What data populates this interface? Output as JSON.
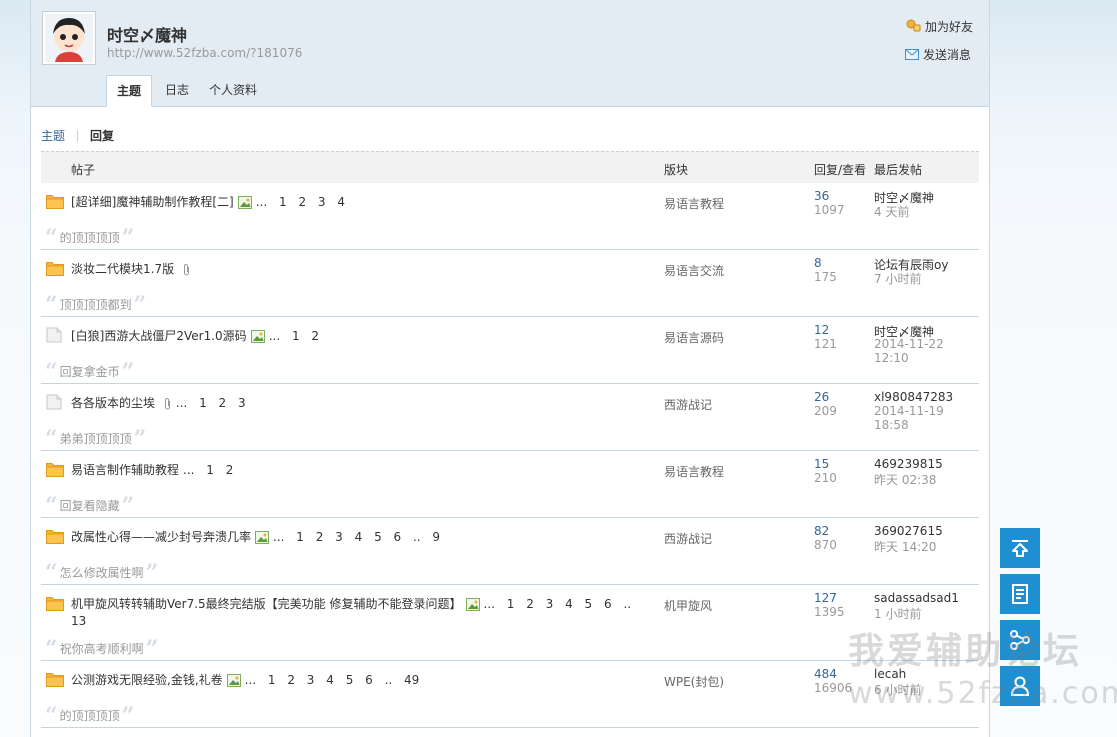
{
  "profile": {
    "name": "时空〆魔神",
    "url": "http://www.52fzba.com/?181076",
    "add_friend": "加为好友",
    "send_message": "发送消息"
  },
  "tabs": [
    "主题",
    "日志",
    "个人资料"
  ],
  "subnav": {
    "topics": "主题",
    "replies": "回复"
  },
  "table_headers": {
    "post": "帖子",
    "forum": "版块",
    "reply_view": "回复/查看",
    "last_post": "最后发帖"
  },
  "threads": [
    {
      "title": "[超详细]魔神辅助制作教程[二]",
      "has_image": true,
      "has_attach": false,
      "pages": "... 1 2 3 4",
      "forum": "易语言教程",
      "replies": "36",
      "views": "1097",
      "last_user": "时空〆魔神",
      "last_time": "4 天前",
      "quote": "的顶顶顶顶",
      "folder": "yellow"
    },
    {
      "title": "淡妆二代模块1.7版",
      "has_image": false,
      "has_attach": true,
      "pages": "",
      "forum": "易语言交流",
      "replies": "8",
      "views": "175",
      "last_user": "论坛有辰雨oy",
      "last_time": "7 小时前",
      "quote": "顶顶顶顶都到",
      "folder": "yellow"
    },
    {
      "title": "[白狼]西游大战僵尸2Ver1.0源码",
      "has_image": true,
      "has_attach": false,
      "pages": "... 1 2",
      "forum": "易语言源码",
      "replies": "12",
      "views": "121",
      "last_user": "时空〆魔神",
      "last_time": "2014-11-22 12:10",
      "quote": "回复拿金币",
      "folder": "gray"
    },
    {
      "title": "各各版本的尘埃",
      "has_image": false,
      "has_attach": true,
      "pages": "... 1 2 3",
      "forum": "西游战记",
      "replies": "26",
      "views": "209",
      "last_user": "xl980847283",
      "last_time": "2014-11-19 18:58",
      "quote": "弟弟顶顶顶顶",
      "folder": "gray"
    },
    {
      "title": "易语言制作辅助教程",
      "has_image": false,
      "has_attach": false,
      "pages": "... 1 2",
      "forum": "易语言教程",
      "replies": "15",
      "views": "210",
      "last_user": "469239815",
      "last_time": "昨天 02:38",
      "quote": "回复看隐藏",
      "folder": "yellow"
    },
    {
      "title": "改属性心得——减少封号奔溃几率",
      "has_image": true,
      "has_attach": false,
      "pages": "... 1 2 3 4 5 6 .. 9",
      "forum": "西游战记",
      "replies": "82",
      "views": "870",
      "last_user": "369027615",
      "last_time": "昨天 14:20",
      "quote": "怎么修改属性啊",
      "folder": "yellow"
    },
    {
      "title": "机甲旋风转转辅助Ver7.5最终完结版【完美功能 修复辅助不能登录问题】",
      "has_image": true,
      "has_attach": false,
      "pages": "... 1 2 3 4 5 6 .. 13",
      "forum": "机甲旋风",
      "replies": "127",
      "views": "1395",
      "last_user": "sadassadsad1",
      "last_time": "1 小时前",
      "quote": "祝你高考顺利啊",
      "folder": "yellow",
      "tall": true
    },
    {
      "title": "公测游戏无限经验,金钱,礼卷",
      "has_image": true,
      "has_attach": false,
      "pages": "... 1 2 3 4 5 6 .. 49",
      "forum": "WPE(封包)",
      "replies": "484",
      "views": "16906",
      "last_user": "lecah",
      "last_time": "6 小时前",
      "quote": "的顶顶顶顶",
      "folder": "yellow"
    }
  ],
  "float_buttons": [
    "back-to-top-icon",
    "document-icon",
    "share-icon",
    "user-icon"
  ],
  "watermark": {
    "line1": "我爱辅助论坛",
    "line2": "www.52fzba.com"
  },
  "colors": {
    "accent": "#336699",
    "float_button": "#1e90d2",
    "header_bg": "#e3ebf3"
  }
}
